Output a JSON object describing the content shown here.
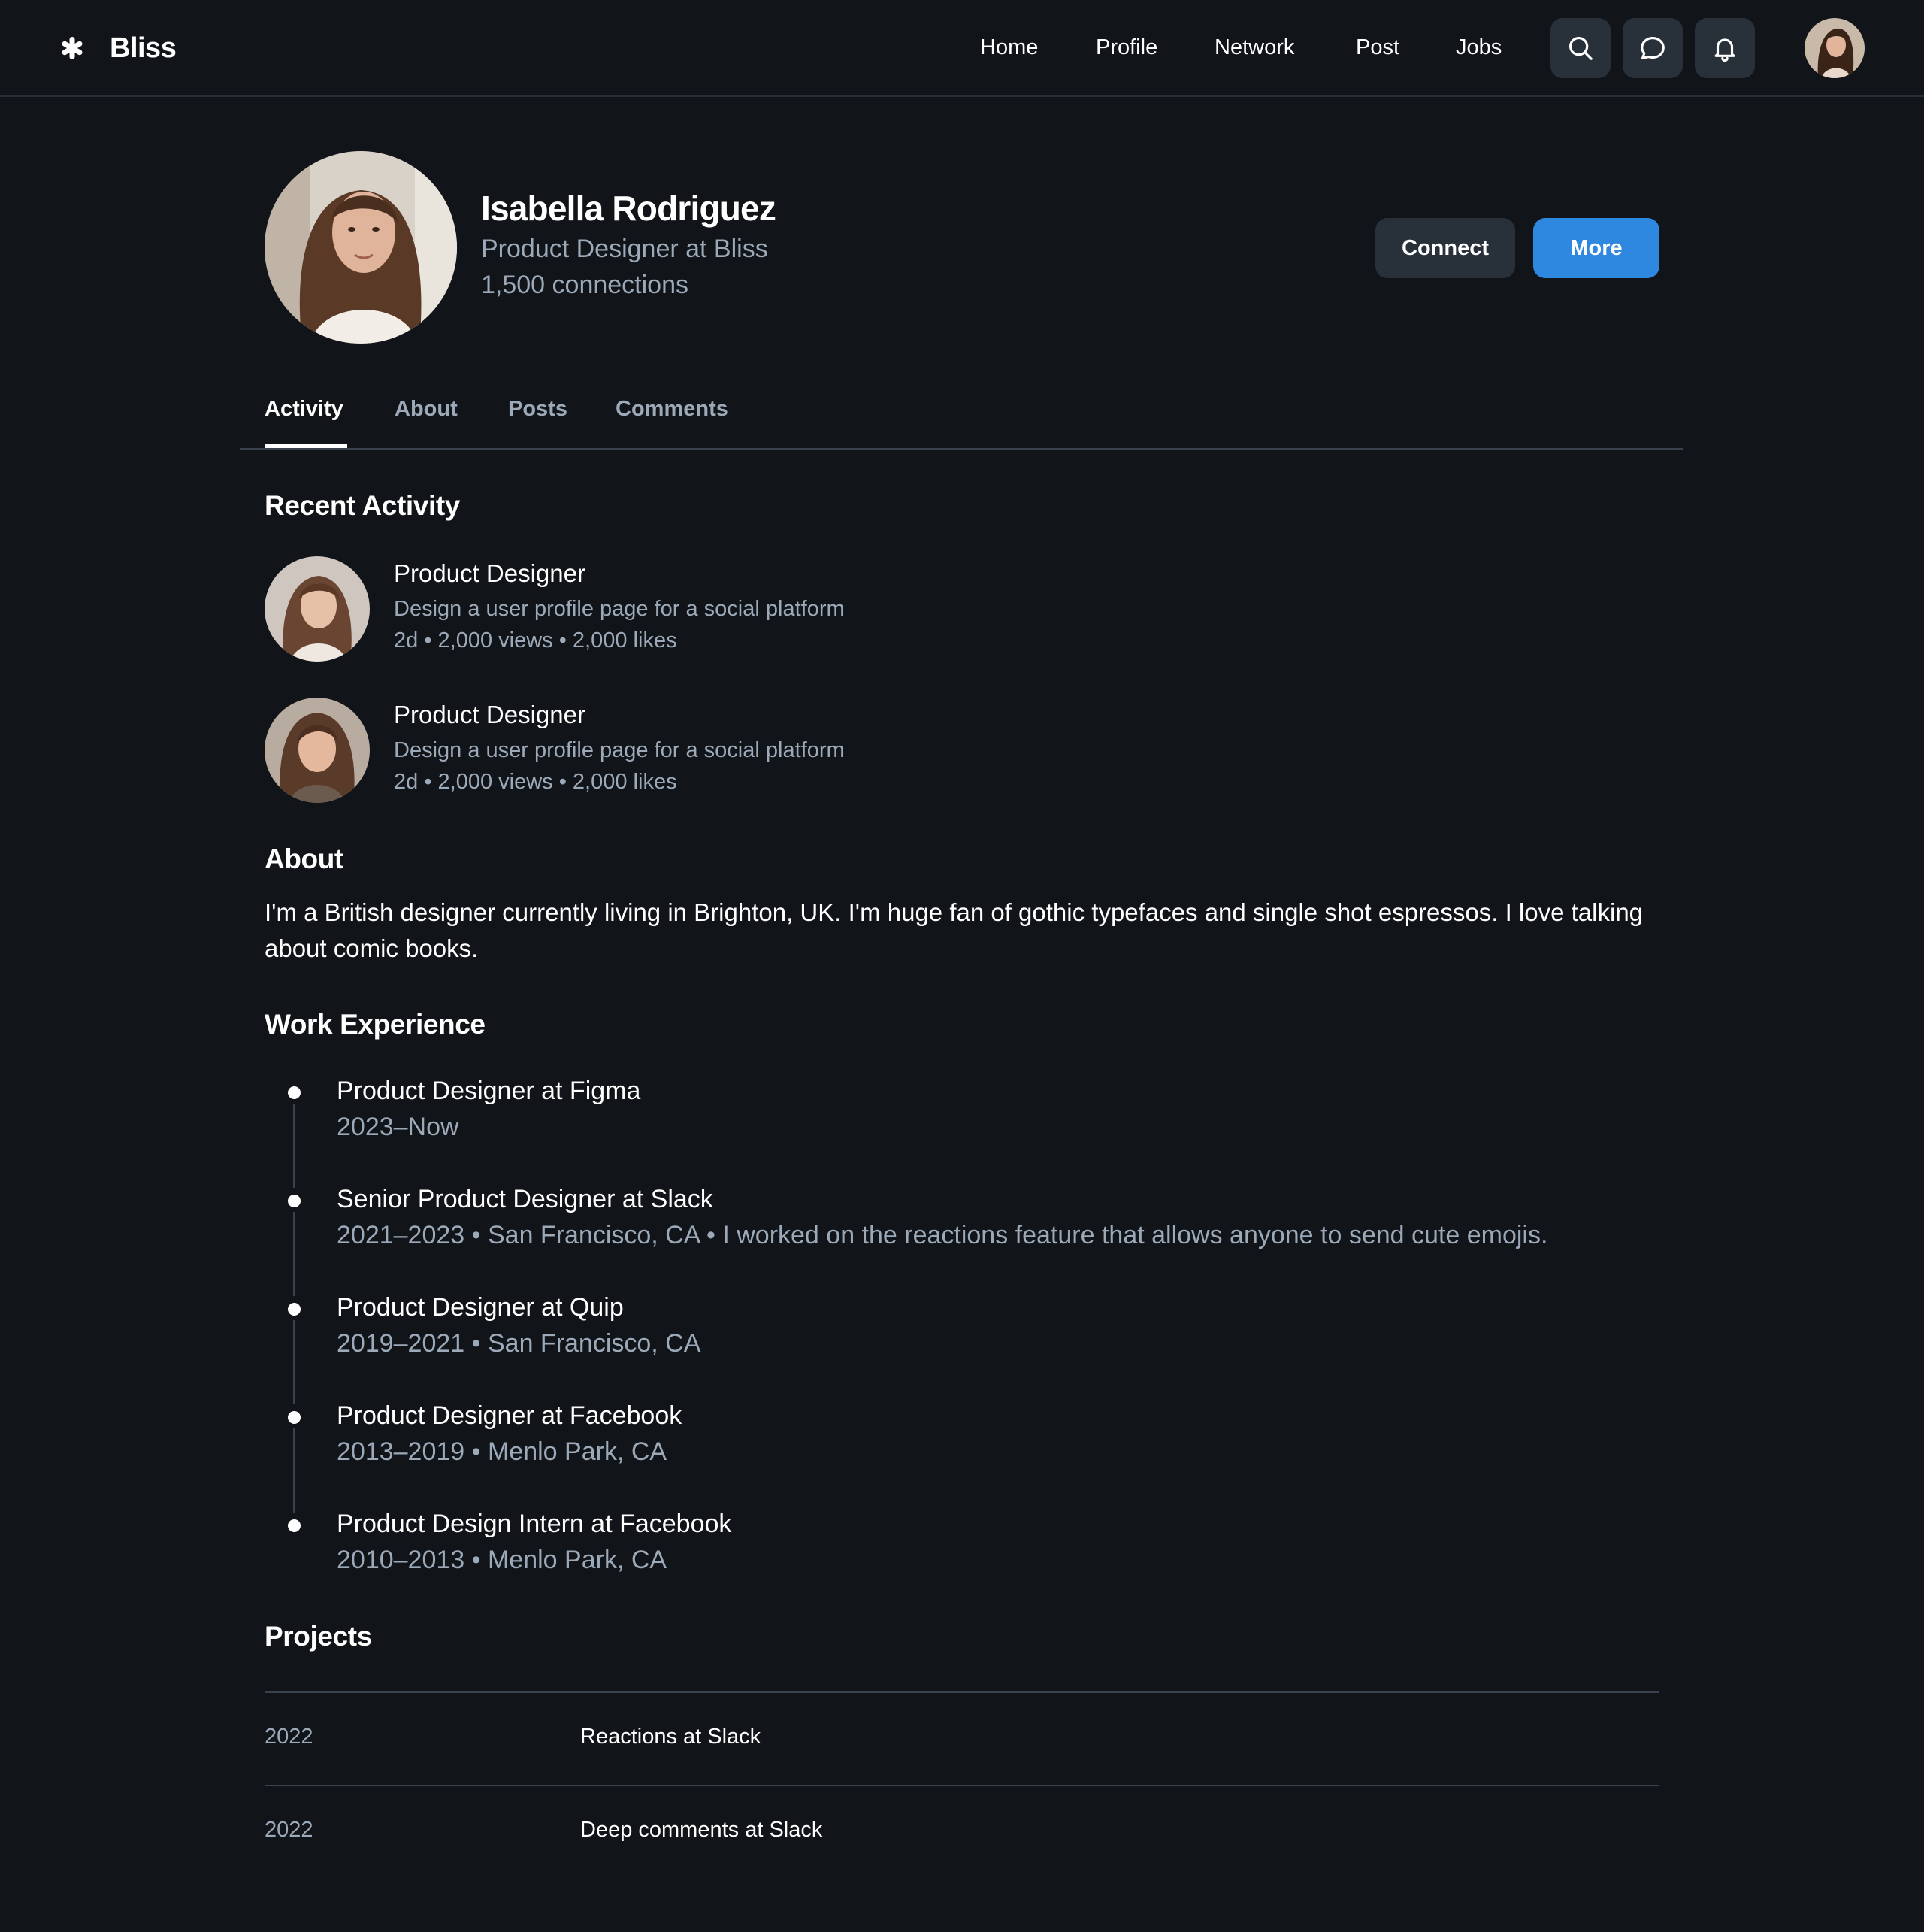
{
  "app": {
    "brand": "Bliss"
  },
  "nav": {
    "items": [
      "Home",
      "Profile",
      "Network",
      "Post",
      "Jobs"
    ]
  },
  "profile": {
    "name": "Isabella Rodriguez",
    "title": "Product Designer at Bliss",
    "connections": "1,500 connections",
    "connect_label": "Connect",
    "more_label": "More"
  },
  "tabs": [
    "Activity",
    "About",
    "Posts",
    "Comments"
  ],
  "recent_activity": {
    "heading": "Recent Activity",
    "items": [
      {
        "title": "Product Designer",
        "description": "Design a user profile page for a social platform",
        "meta": "2d • 2,000 views • 2,000 likes"
      },
      {
        "title": "Product Designer",
        "description": "Design a user profile page for a social platform",
        "meta": "2d • 2,000 views • 2,000 likes"
      }
    ]
  },
  "about": {
    "heading": "About",
    "text": "I'm a British designer currently living in Brighton, UK. I'm huge fan of gothic typefaces and single shot espressos. I love talking about comic books."
  },
  "work_experience": {
    "heading": "Work Experience",
    "items": [
      {
        "title": "Product Designer at Figma",
        "details": "2023–Now"
      },
      {
        "title": "Senior Product Designer at Slack",
        "details": "2021–2023 • San Francisco, CA • I worked on the reactions feature that allows anyone to send cute emojis."
      },
      {
        "title": "Product Designer at Quip",
        "details": "2019–2021 • San Francisco, CA"
      },
      {
        "title": "Product Designer at Facebook",
        "details": "2013–2019 • Menlo Park, CA"
      },
      {
        "title": "Product Design Intern at Facebook",
        "details": "2010–2013 • Menlo Park, CA"
      }
    ]
  },
  "projects": {
    "heading": "Projects",
    "items": [
      {
        "year": "2022",
        "name": "Reactions at Slack"
      },
      {
        "year": "2022",
        "name": "Deep comments at Slack"
      }
    ]
  },
  "colors": {
    "background": "#111418",
    "surface": "#283039",
    "accent": "#2f88e0",
    "muted_text": "#9ca9b8",
    "divider": "#3a434d"
  },
  "icons": [
    "asterisk-logo-icon",
    "search-icon",
    "chat-bubble-icon",
    "bell-icon"
  ]
}
